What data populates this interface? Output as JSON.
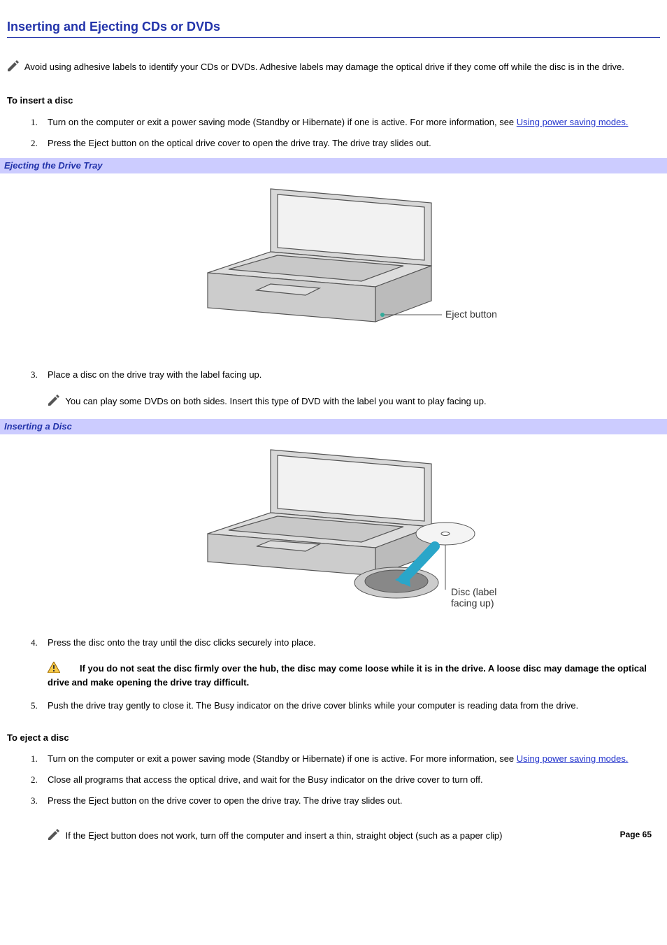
{
  "title": "Inserting and Ejecting CDs or DVDs",
  "note_top": "Avoid using adhesive labels to identify your CDs or DVDs. Adhesive labels may damage the optical drive if they come off while the disc is in the drive.",
  "insert": {
    "heading": "To insert a disc",
    "step1_pre": "Turn on the computer or exit a power saving mode (Standby or Hibernate) if one is active. For more information, see ",
    "step1_link": "Using power saving modes.",
    "step2": "Press the Eject button on the optical drive cover to open the drive tray. The drive tray slides out.",
    "caption1": "Ejecting the Drive Tray",
    "fig1_label": "Eject button",
    "step3": "Place a disc on the drive tray with the label facing up.",
    "note3": "You can play some DVDs on both sides. Insert this type of DVD with the label you want to play facing up.",
    "caption2": "Inserting a Disc",
    "fig2_label1": "Disc (label",
    "fig2_label2": "facing up)",
    "step4": "Press the disc onto the tray until the disc clicks securely into place.",
    "warn": "If you do not seat the disc firmly over the hub, the disc may come loose while it is in the drive. A loose disc may damage the optical drive and make opening the drive tray difficult.",
    "step5": "Push the drive tray gently to close it. The Busy indicator on the drive cover blinks while your computer is reading data from the drive."
  },
  "eject": {
    "heading": "To eject a disc",
    "step1_pre": "Turn on the computer or exit a power saving mode (Standby or Hibernate) if one is active. For more information, see ",
    "step1_link": "Using power saving modes.",
    "step2": "Close all programs that access the optical drive, and wait for the Busy indicator on the drive cover to turn off.",
    "step3": "Press the Eject button on the drive cover to open the drive tray. The drive tray slides out.",
    "note_bottom": "If the Eject button does not work, turn off the computer and insert a thin, straight object (such as a paper clip)"
  },
  "page_number": "Page 65"
}
